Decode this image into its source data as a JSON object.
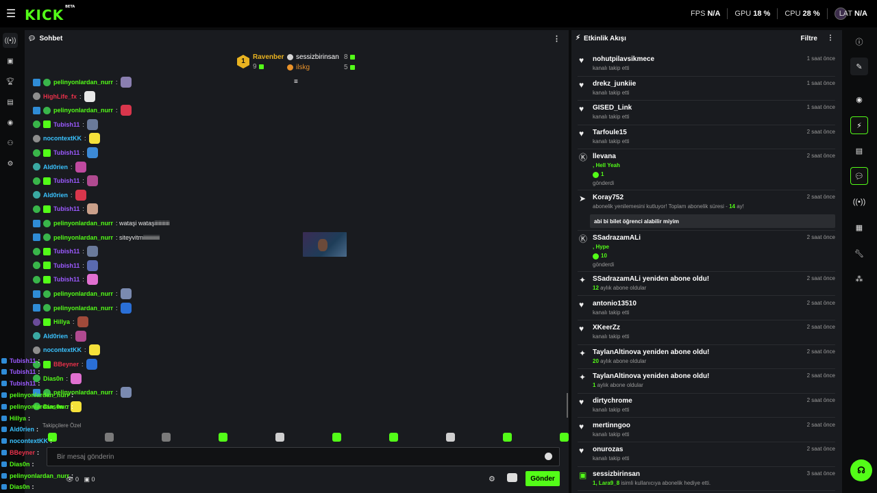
{
  "app": {
    "logo": "KICK",
    "logo_badge": "BETA"
  },
  "stats": {
    "fps_label": "FPS",
    "fps_value": "N/A",
    "gpu_label": "GPU",
    "gpu_value": "18 %",
    "cpu_label": "CPU",
    "cpu_value": "28 %",
    "lat_label": "LAT",
    "lat_value": "N/A"
  },
  "chat": {
    "title": "Sohbet",
    "leaderboard": {
      "rank": "1",
      "first_name": "Ravenber",
      "first_count": "9",
      "second_name": "sessizbirinsan",
      "second_count": "8",
      "third_name": "ilskg",
      "third_count": "5"
    },
    "messages": [
      {
        "name": "pelinyonlardan_nurr",
        "color": "#53fc18",
        "badges": [
          "blue",
          "green"
        ],
        "text": ":",
        "emote": "#8a7fb0"
      },
      {
        "name": "HighLife_fx",
        "color": "#e8314a",
        "badges": [
          "gray"
        ],
        "text": ":",
        "emote": "#e8e8e8"
      },
      {
        "name": "pelinyonlardan_nurr",
        "color": "#53fc18",
        "badges": [
          "blue",
          "green"
        ],
        "text": ":",
        "emote": "#d9364c"
      },
      {
        "name": "Tubish11",
        "color": "#9b59ff",
        "badges": [
          "green",
          "grn2"
        ],
        "text": ":",
        "emote": "#6a7a9a"
      },
      {
        "name": "nocontextKK",
        "color": "#3ac3ff",
        "badges": [
          "gray"
        ],
        "text": ":",
        "emote": "#f5e13a"
      },
      {
        "name": "Tubish11",
        "color": "#9b59ff",
        "badges": [
          "green",
          "grn2"
        ],
        "text": ":",
        "emote": "#3c8ad6"
      },
      {
        "name": "Ald0rien",
        "color": "#3ac3ff",
        "badges": [
          "teal"
        ],
        "text": ":",
        "emote": "#c04aa0"
      },
      {
        "name": "Tubish11",
        "color": "#9b59ff",
        "badges": [
          "green",
          "grn2"
        ],
        "text": ":",
        "emote": "#b04a90"
      },
      {
        "name": "Ald0rien",
        "color": "#3ac3ff",
        "badges": [
          "teal"
        ],
        "text": ":",
        "emote": "#d9364c"
      },
      {
        "name": "Tubish11",
        "color": "#9b59ff",
        "badges": [
          "green",
          "grn2"
        ],
        "text": ":",
        "emote": "#caa08a"
      },
      {
        "name": "pelinyonlardan_nurr",
        "color": "#53fc18",
        "badges": [
          "blue",
          "green"
        ],
        "text": ": wataşi wataşiiiiiiiiiii",
        "emote": ""
      },
      {
        "name": "pelinyonlardan_nurr",
        "color": "#53fc18",
        "badges": [
          "blue",
          "green"
        ],
        "text": ": siteyvitmiiiiiiiiiiii",
        "emote": ""
      },
      {
        "name": "Tubish11",
        "color": "#9b59ff",
        "badges": [
          "green",
          "grn2"
        ],
        "text": ":",
        "emote": "#6a7a9a"
      },
      {
        "name": "Tubish11",
        "color": "#9b59ff",
        "badges": [
          "green",
          "grn2"
        ],
        "text": ":",
        "emote": "#5a6ab0"
      },
      {
        "name": "Tubish11",
        "color": "#9b59ff",
        "badges": [
          "green",
          "grn2"
        ],
        "text": ":",
        "emote": "#e070d0"
      },
      {
        "name": "pelinyonlardan_nurr",
        "color": "#53fc18",
        "badges": [
          "blue",
          "green"
        ],
        "text": ":",
        "emote": "#7a8ab0"
      },
      {
        "name": "pelinyonlardan_nurr",
        "color": "#53fc18",
        "badges": [
          "blue",
          "green"
        ],
        "text": ":",
        "emote": "#2a6fd6"
      },
      {
        "name": "Hillya",
        "color": "#53fc18",
        "badges": [
          "purp",
          "grn2"
        ],
        "text": ":",
        "emote": "#a04a3a"
      },
      {
        "name": "Ald0rien",
        "color": "#3ac3ff",
        "badges": [
          "teal"
        ],
        "text": ":",
        "emote": "#b04a90"
      },
      {
        "name": "nocontextKK",
        "color": "#3ac3ff",
        "badges": [
          "gray"
        ],
        "text": ":",
        "emote": "#f5e13a"
      },
      {
        "name": "BBeyner",
        "color": "#e8314a",
        "badges": [
          "green",
          "grn2"
        ],
        "text": ":",
        "emote": "#2a6fd6"
      },
      {
        "name": "Dias0n",
        "color": "#53fc18",
        "badges": [
          "green"
        ],
        "text": ":",
        "emote": "#e070d0"
      },
      {
        "name": "pelinyonlardan_nurr",
        "color": "#53fc18",
        "badges": [
          "blue",
          "green"
        ],
        "text": ":",
        "emote": "#7a8ab0"
      },
      {
        "name": "Dias0n",
        "color": "#53fc18",
        "badges": [
          "green"
        ],
        "text": ":",
        "emote": "#f5e13a"
      }
    ],
    "overlay": [
      {
        "name": "Tubish11",
        "color": "#9b59ff",
        "suffix": ":"
      },
      {
        "name": "Tubish11",
        "color": "#9b59ff",
        "suffix": ":"
      },
      {
        "name": "Tubish11",
        "color": "#9b59ff",
        "suffix": ":"
      },
      {
        "name": "pelinyonlardan_nurr",
        "color": "#53fc18",
        "suffix": ":"
      },
      {
        "name": "pelinyonlardan_nurr",
        "color": "#53fc18",
        "suffix": ":"
      },
      {
        "name": "Hillya",
        "color": "#53fc18",
        "suffix": ":"
      },
      {
        "name": "Ald0rien",
        "color": "#3ac3ff",
        "suffix": ":"
      },
      {
        "name": "nocontextKK",
        "color": "#3ac3ff",
        "suffix": ":"
      },
      {
        "name": "BBeyner",
        "color": "#e8314a",
        "suffix": ":"
      },
      {
        "name": "Dias0n",
        "color": "#53fc18",
        "suffix": ":"
      },
      {
        "name": "pelinyonlardan_nurr",
        "color": "#53fc18",
        "suffix": ":"
      },
      {
        "name": "Dias0n",
        "color": "#53fc18",
        "suffix": ":"
      }
    ],
    "followers_label": "Takipçilere Özel",
    "input_placeholder": "Bir mesaj gönderin",
    "send_label": "Gönder",
    "viewer_count": "0",
    "sub_count": "0"
  },
  "feed": {
    "title": "Etkinlik Akışı",
    "filter_label": "Filtre",
    "items": [
      {
        "icon": "heart-icon",
        "name": "nohutpilavsikmece",
        "sub": "kanalı takip etti",
        "time": "1 saat önce"
      },
      {
        "icon": "heart-icon",
        "name": "drekz_junkiie",
        "sub": "kanalı takip etti",
        "time": "1 saat önce"
      },
      {
        "icon": "heart-icon",
        "name": "GISED_Link",
        "sub": "kanalı takip etti",
        "time": "1 saat önce"
      },
      {
        "icon": "heart-icon",
        "name": "Tarfoule15",
        "sub": "kanalı takip etti",
        "time": "2 saat önce"
      },
      {
        "icon": "kicks-icon",
        "name": "llevana",
        "line1": ", Hell Yeah",
        "line2": "1",
        "line3": "gönderdi",
        "time": "2 saat önce"
      },
      {
        "icon": "resub-icon",
        "name": "Koray752",
        "sub_pre": "abonelik yenilemesini kutluyor! Toplam abonelik süresi - ",
        "sub_num": "14",
        "sub_post": " ay!",
        "quote": "abi bi bilet öğrenci alabilir miyim",
        "time": "2 saat önce"
      },
      {
        "icon": "kicks-icon",
        "name": "SSadrazamALi",
        "line1": ", Hype",
        "line2": "10",
        "line3": "gönderdi",
        "time": "2 saat önce"
      },
      {
        "icon": "sparkle-icon",
        "name": "SSadrazamALi yeniden abone oldu!",
        "sub_num": "12",
        "sub_post": " aylık abone oldular",
        "time": "2 saat önce"
      },
      {
        "icon": "heart-icon",
        "name": "antonio13510",
        "sub": "kanalı takip etti",
        "time": "2 saat önce"
      },
      {
        "icon": "heart-icon",
        "name": "XKeerZz",
        "sub": "kanalı takip etti",
        "time": "2 saat önce"
      },
      {
        "icon": "sparkle-icon",
        "name": "TaylanAltinova yeniden abone oldu!",
        "sub_num": "20",
        "sub_post": " aylık abone oldular",
        "time": "2 saat önce"
      },
      {
        "icon": "sparkle-icon",
        "name": "TaylanAltinova yeniden abone oldu!",
        "sub_num": "1",
        "sub_post": " aylık abone oldular",
        "time": "2 saat önce"
      },
      {
        "icon": "heart-icon",
        "name": "dirtychrome",
        "sub": "kanalı takip etti",
        "time": "2 saat önce"
      },
      {
        "icon": "heart-icon",
        "name": "mertinngoo",
        "sub": "kanalı takip etti",
        "time": "2 saat önce"
      },
      {
        "icon": "heart-icon",
        "name": "onurozas",
        "sub": "kanalı takip etti",
        "time": "2 saat önce"
      },
      {
        "icon": "gift-icon",
        "name": "sessizbirinsan",
        "sub_num": "1, Lara9_8",
        "sub_post": " isimli kullanıcıya abonelik hediye etti.",
        "time": "3 saat önce"
      }
    ]
  }
}
